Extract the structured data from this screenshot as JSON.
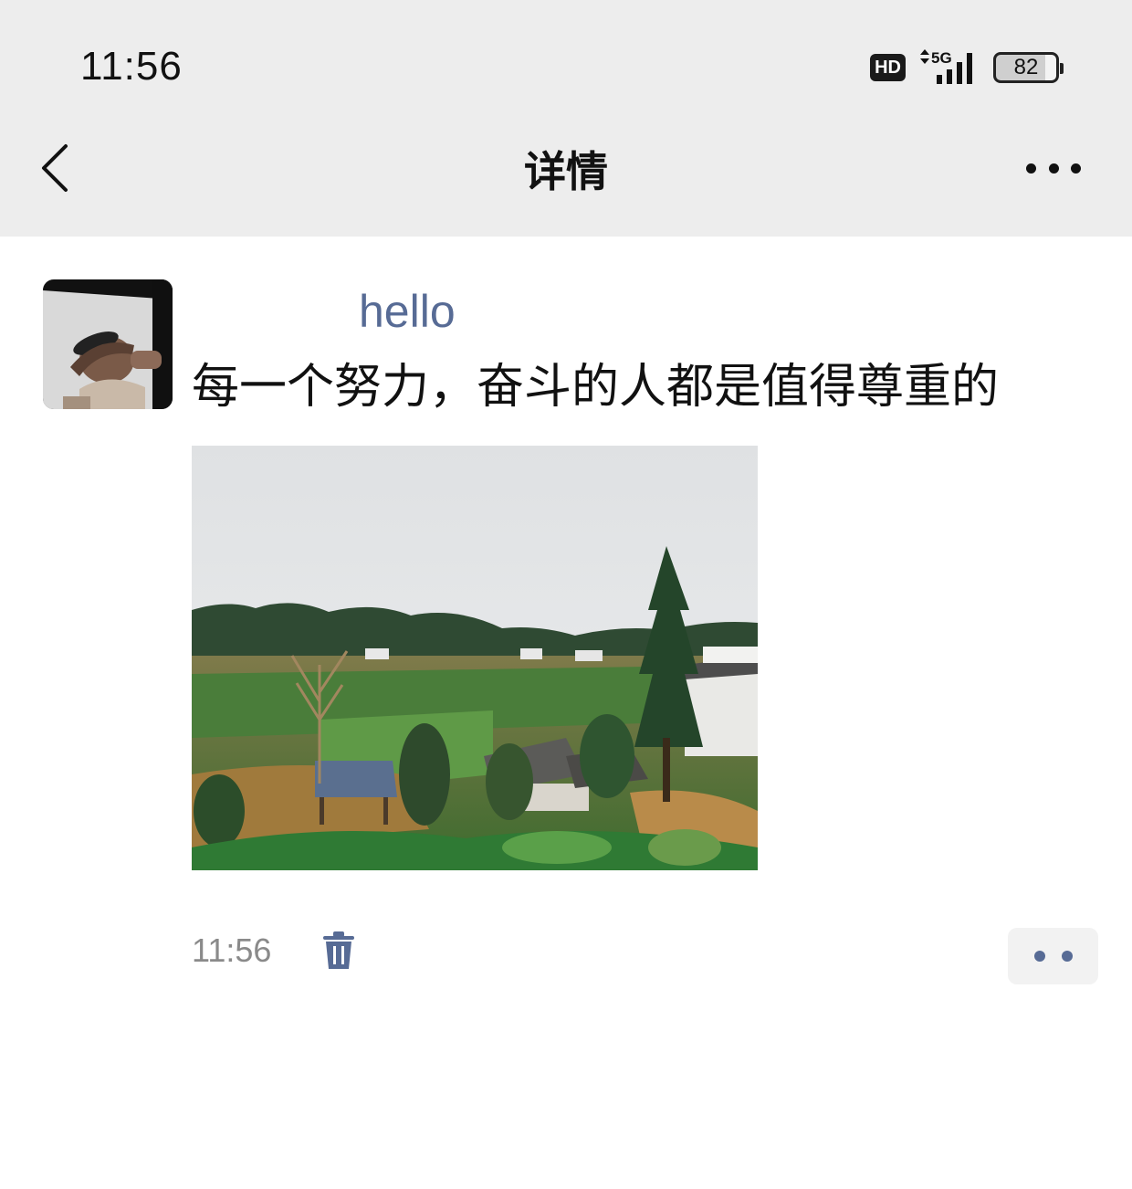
{
  "status_bar": {
    "time": "11:56",
    "hd_label": "HD",
    "network_label": "5G",
    "battery_level": "82"
  },
  "header": {
    "title": "详情",
    "back_icon": "chevron-left-icon",
    "more_icon": "more-horizontal-icon"
  },
  "post": {
    "author": "hello",
    "text": "每一个努力，奋斗的人都是值得尊重的",
    "time": "11:56",
    "delete_icon": "trash-icon",
    "action_icon": "comment-like-dots-icon"
  },
  "colors": {
    "header_bg": "#ededed",
    "link_blue": "#576b95",
    "text_primary": "#111111",
    "text_secondary": "#8a8a8a"
  }
}
